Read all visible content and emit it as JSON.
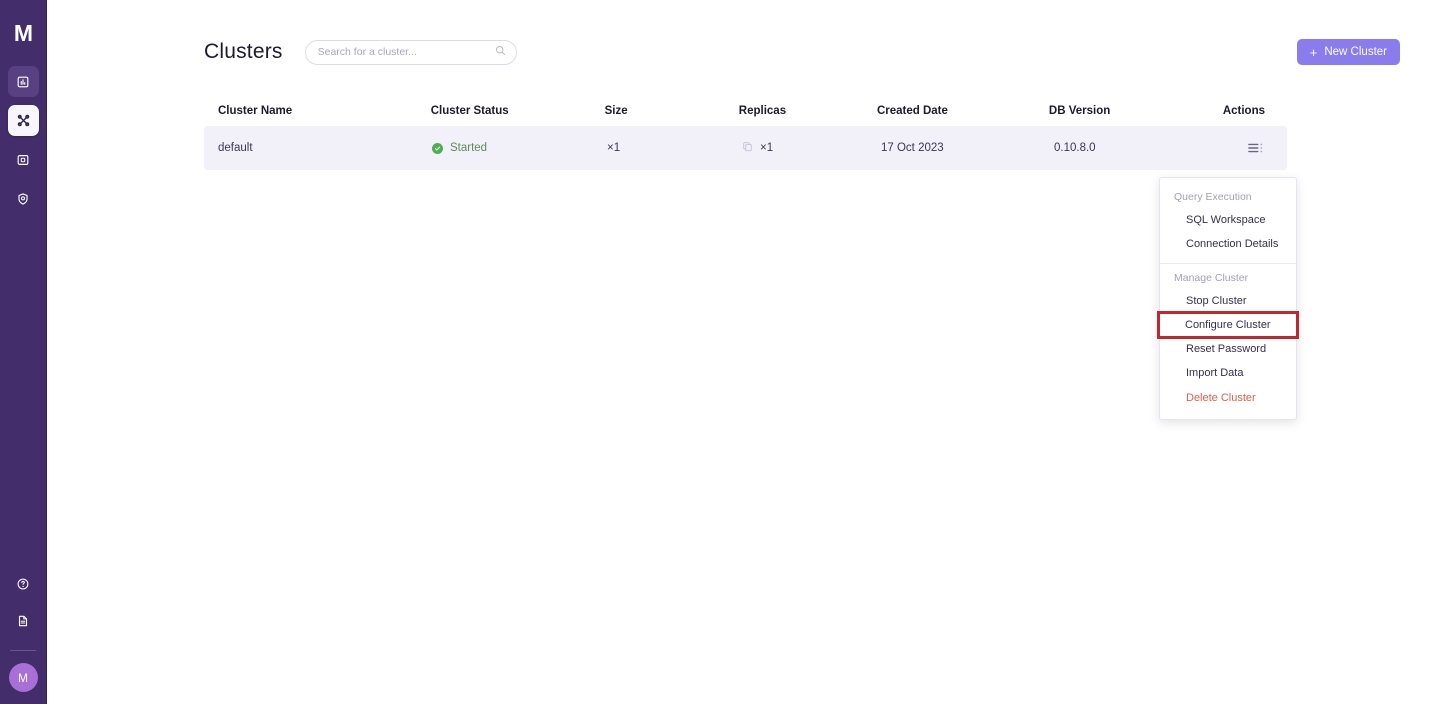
{
  "sidebar": {
    "logo_text": "M",
    "items": [
      {
        "name": "sidebar-item-dashboard",
        "icon": "dashboard-icon",
        "state": "hovered"
      },
      {
        "name": "sidebar-item-clusters",
        "icon": "clusters-icon",
        "state": "active"
      },
      {
        "name": "sidebar-item-backups",
        "icon": "backups-icon",
        "state": "default"
      },
      {
        "name": "sidebar-item-security",
        "icon": "shield-icon",
        "state": "default"
      }
    ],
    "bottom_items": [
      {
        "name": "sidebar-item-help",
        "icon": "help-circle-icon"
      },
      {
        "name": "sidebar-item-docs",
        "icon": "document-icon"
      }
    ],
    "avatar_text": "M"
  },
  "header": {
    "title": "Clusters",
    "search": {
      "value": "",
      "placeholder": "Search for a cluster...",
      "icon": "search-icon"
    },
    "new_cluster_label": "New Cluster",
    "new_cluster_plus": "+"
  },
  "table": {
    "columns": [
      "Cluster Name",
      "Cluster Status",
      "Size",
      "Replicas",
      "Created Date",
      "DB Version",
      "Actions"
    ],
    "rows": [
      {
        "name": "default",
        "status": "Started",
        "status_icon": "check-circle-icon",
        "size": "×1",
        "replicas": "×1",
        "replicas_icon": "copy-icon",
        "created": "17 Oct 2023",
        "version": "0.10.8.0",
        "actions_icon": "list-menu-icon"
      }
    ]
  },
  "context_menu": {
    "sections": [
      {
        "label": "Query Execution",
        "items": [
          {
            "label": "SQL Workspace",
            "style": "normal"
          },
          {
            "label": "Connection Details",
            "style": "normal"
          }
        ]
      },
      {
        "label": "Manage Cluster",
        "items": [
          {
            "label": "Stop Cluster",
            "style": "normal"
          },
          {
            "label": "Configure Cluster",
            "style": "highlighted"
          },
          {
            "label": "Reset Password",
            "style": "normal"
          },
          {
            "label": "Import Data",
            "style": "normal"
          },
          {
            "label": "Delete Cluster",
            "style": "danger"
          }
        ]
      }
    ]
  },
  "colors": {
    "sidebar_bg": "#432D6B",
    "accent": "#8B7CED",
    "row_bg": "#F2F1F9",
    "status_green": "#4CAF50",
    "danger": "#D9604F",
    "highlight_outline": "#C1272D",
    "avatar_bg": "#A86FD6"
  }
}
